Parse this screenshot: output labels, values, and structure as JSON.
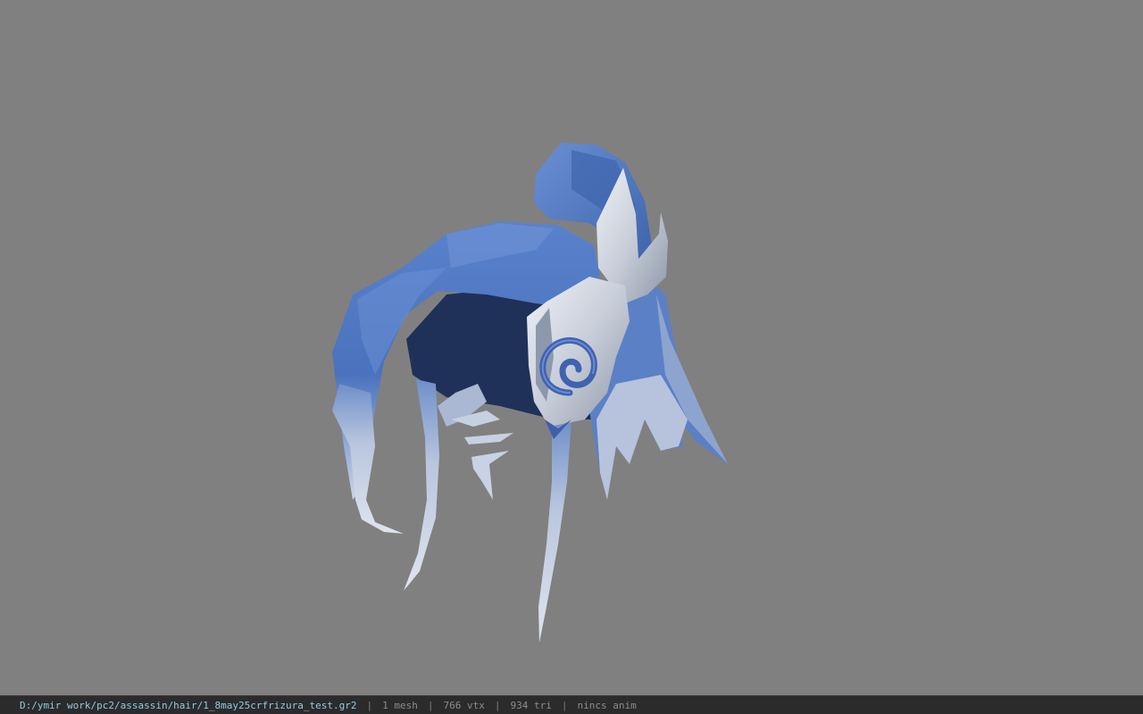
{
  "viewport": {
    "background": "#808080",
    "model_colors": {
      "hair_blue": "#4f78c2",
      "hair_dark": "#22355f",
      "hair_light": "#c9d3e6",
      "ornament_silver": "#d4d9e2"
    }
  },
  "status_bar": {
    "file_path": "D:/ymir work/pc2/assassin/hair/1_8may25crfrizura_test.gr2",
    "mesh_count": "1 mesh",
    "vertex_count": "766 vtx",
    "triangle_count": "934 tri",
    "anim_status": "nincs anim",
    "separator": "|"
  }
}
